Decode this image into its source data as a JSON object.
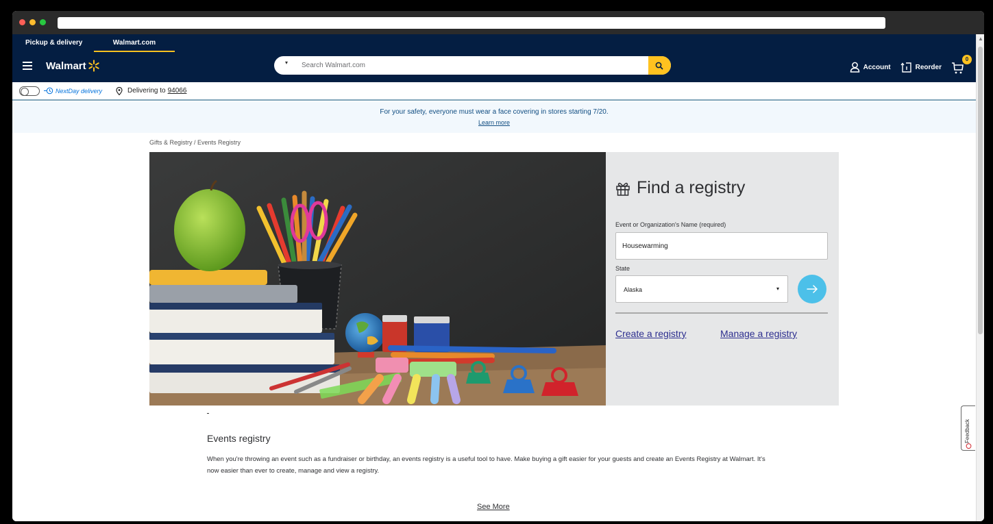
{
  "header": {
    "tabs": [
      "Pickup & delivery",
      "Walmart.com"
    ],
    "logo_text": "Walmart",
    "search_placeholder": "Search Walmart.com",
    "account_label": "Account",
    "reorder_label": "Reorder",
    "cart_count": "0",
    "brand_colors": {
      "navy": "#041e42",
      "yellow": "#ffc220",
      "blue": "#0071dc"
    }
  },
  "subbar": {
    "nextday_label": "NextDay delivery",
    "delivering_label": "Delivering to",
    "zip": "94066"
  },
  "banner": {
    "message": "For your safety, everyone must wear a face covering in stores starting 7/20.",
    "link": "Learn more"
  },
  "breadcrumb": "Gifts & Registry / Events Registry",
  "registry": {
    "title": "Find a registry",
    "name_label": "Event or Organization's Name (required)",
    "name_value": "Housewarming",
    "state_label": "State",
    "state_value": "Alaska",
    "create_link": "Create a registry",
    "manage_link": "Manage a registry"
  },
  "section": {
    "title": "Events registry",
    "body": "When you're throwing an event such as a fundraiser or birthday, an events registry is a useful tool to have. Make buying a gift easier for your guests and create an Events Registry at Walmart. It's now easier than ever to create, manage and view a registry.",
    "see_more": "See More"
  },
  "feedback_label": "Feedback"
}
